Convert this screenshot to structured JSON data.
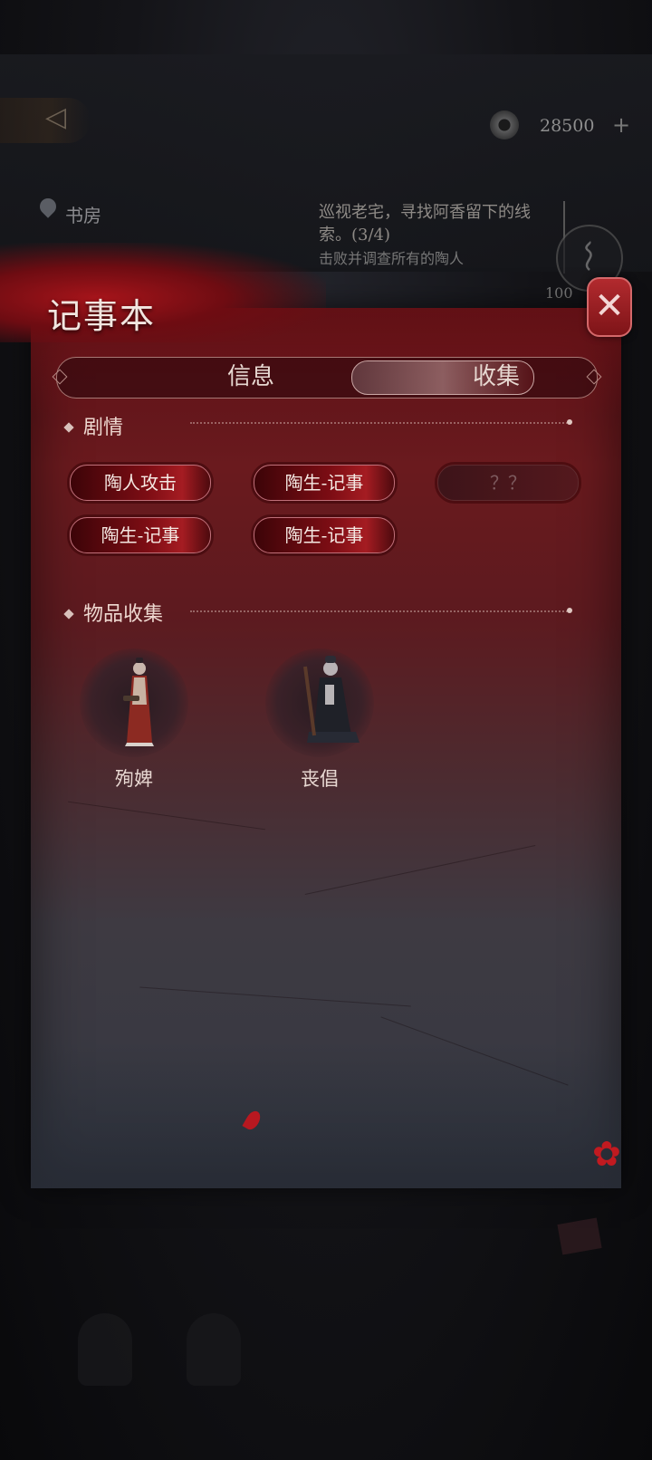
{
  "hud": {
    "currency_value": "28500",
    "currency_plus": "+",
    "back_arrow": "◁",
    "location": "书房",
    "quest_text": "巡视老宅，寻找阿香留下的线索。(3/4)",
    "quest_sub": "击败并调查所有的陶人",
    "partial_value": "100"
  },
  "panel": {
    "title": "记事本",
    "close_symbol": "✕",
    "tabs": [
      {
        "label": "信息",
        "active": false
      },
      {
        "label": "收集",
        "active": true
      }
    ],
    "story_section": {
      "heading": "剧情",
      "entries": [
        {
          "label": "陶人攻击",
          "locked": false
        },
        {
          "label": "陶生-记事",
          "locked": false
        },
        {
          "label": "？？",
          "locked": true
        },
        {
          "label": "陶生-记事",
          "locked": false
        },
        {
          "label": "陶生-记事",
          "locked": false
        }
      ]
    },
    "item_section": {
      "heading": "物品收集",
      "items": [
        {
          "name": "殉婢",
          "icon": "maid-figure-icon"
        },
        {
          "name": "丧倡",
          "icon": "kneeling-musician-figure-icon"
        }
      ]
    }
  },
  "colors": {
    "panel_red": "#6a1a1e",
    "button_red": "#a51c22",
    "accent_text": "#f5e8e2"
  }
}
